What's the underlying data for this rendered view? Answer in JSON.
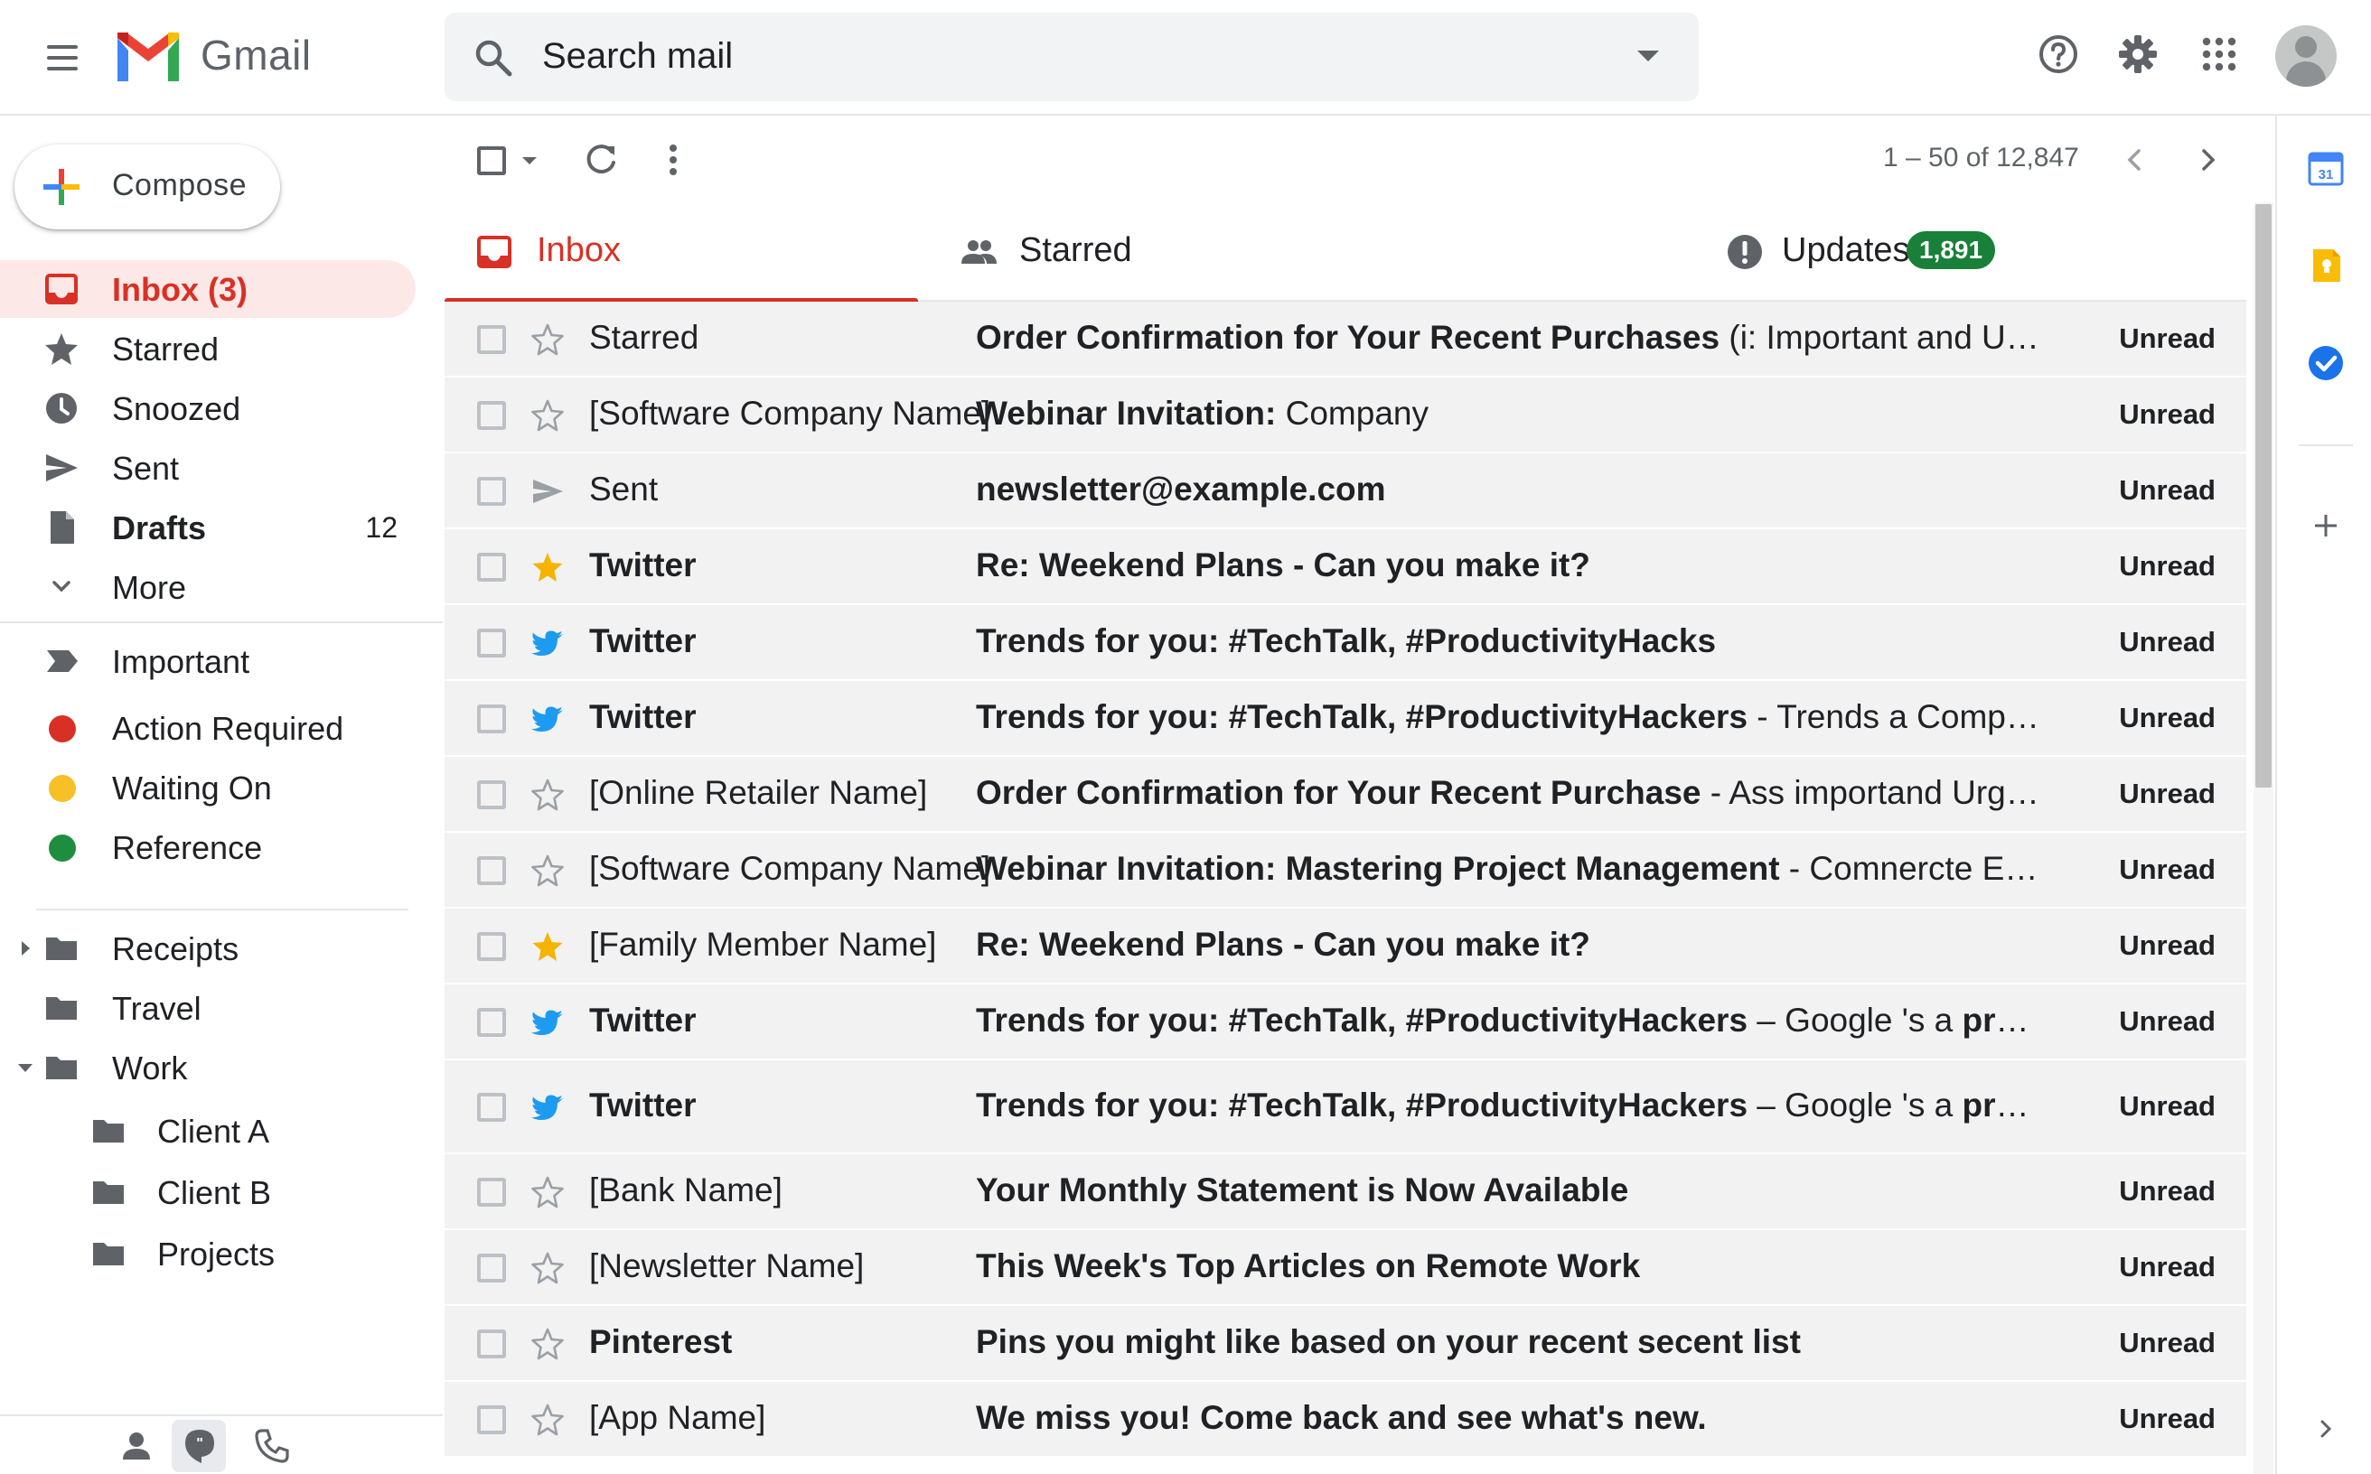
{
  "header": {
    "brand": "Gmail",
    "search_placeholder": "Search mail"
  },
  "compose": {
    "label": "Compose"
  },
  "nav": {
    "inbox": "Inbox (3)",
    "starred": "Starred",
    "snoozed": "Snoozed",
    "sent": "Sent",
    "drafts": "Drafts",
    "drafts_count": "12",
    "more": "More"
  },
  "labels": {
    "important": "Important",
    "action_required": "Action Required",
    "waiting_on": "Waiting On",
    "reference": "Reference"
  },
  "label_colors": {
    "action_required": "#d93025",
    "waiting_on": "#f6c026",
    "reference": "#1e8e3e"
  },
  "folders": {
    "receipts": "Receipts",
    "travel": "Travel",
    "work": "Work",
    "client_a": "Client A",
    "client_b": "Client B",
    "projects": "Projects"
  },
  "toolbar": {
    "pager": "1 – 50 of 12,847"
  },
  "tabs": {
    "inbox": "Inbox",
    "starred": "Starred",
    "updates": "Updates",
    "updates_badge": "1,891"
  },
  "emails": [
    {
      "icon": "star-outline-icon",
      "sender": "Starred",
      "subject_bold": "Order Confirmation for Your Recent Purchases",
      "snippet": " (i: Important and Urgent!)",
      "status": "Unread"
    },
    {
      "icon": "star-outline-icon",
      "sender": "[Software Company Name]",
      "subject_bold": "Webinar Invitation:",
      "snippet": " Company",
      "status": "Unread"
    },
    {
      "icon": "send-icon",
      "sender": "Sent",
      "subject_bold": "newsletter@example.com",
      "snippet": "",
      "status": "Unread"
    },
    {
      "icon": "star-filled-icon",
      "sender": "Twitter",
      "subject_bold": "Re: Weekend Plans - Can you make it?",
      "snippet": "",
      "status": "Unread"
    },
    {
      "icon": "twitter-icon",
      "sender": "Twitter",
      "subject_bold": "Trends for you: #TechTalk, #ProductivityHacks",
      "snippet": "",
      "status": "Unread"
    },
    {
      "icon": "twitter-icon",
      "sender": "Twitter",
      "subject_bold": "Trends for you: #TechTalk, #ProductivityHackers",
      "snippet": " - Trends a Company: Ivordo...",
      "status": "Unread"
    },
    {
      "icon": "star-outline-icon",
      "sender": "[Online Retailer Name]",
      "subject_bold": "Order Confirmation for Your Recent Purchase",
      "snippet": " - Ass importand Urgent for at th...",
      "status": "Unread"
    },
    {
      "icon": "star-outline-icon",
      "sender": "[Software Company Name]",
      "subject_bold": "Webinar Invitation: Mastering Project Management",
      "snippet": " - Comnercte Exenbiors int...",
      "status": "Unread"
    },
    {
      "icon": "star-filled-icon",
      "sender": "[Family Member Name]",
      "subject_bold": "Re: Weekend Plans - Can you make it?",
      "snippet": "",
      "status": "Unread"
    },
    {
      "icon": "twitter-icon",
      "sender": "Twitter",
      "subject_bold": "Trends for you: #TechTalk, #ProductivityHackers",
      "snippet": " – Google 's a ",
      "snippet_bold": "productivityHa...",
      "status": "Unread"
    },
    {
      "icon": "twitter-icon",
      "sender": "Twitter",
      "subject_bold": "Trends for you: #TechTalk, #ProductivityHackers",
      "snippet": " – Google 's a ",
      "snippet_bold": "productivityHa...",
      "status": "Unread"
    },
    {
      "icon": "star-outline-icon",
      "sender": "[Bank Name]",
      "subject_bold": "Your Monthly Statement is Now Available",
      "snippet": "",
      "status": "Unread"
    },
    {
      "icon": "star-outline-icon",
      "sender": "[Newsletter Name]",
      "subject_bold": "This Week's Top Articles on Remote Work",
      "snippet": "",
      "status": "Unread"
    },
    {
      "icon": "star-outline-icon",
      "sender": "Pinterest",
      "subject_bold": "Pins you might like based on your recent secent list",
      "snippet": "",
      "status": "Unread"
    },
    {
      "icon": "star-outline-icon",
      "sender": "[App Name]",
      "subject_bold": "We miss you! Come back and see what's new.",
      "snippet": "",
      "status": "Unread"
    }
  ],
  "bold_senders": [
    "Twitter",
    "Pinterest"
  ],
  "colors": {
    "accent_red": "#d93025",
    "twitter_blue": "#1d9bf0",
    "star_yellow": "#f4b400",
    "badge_green": "#188038"
  }
}
